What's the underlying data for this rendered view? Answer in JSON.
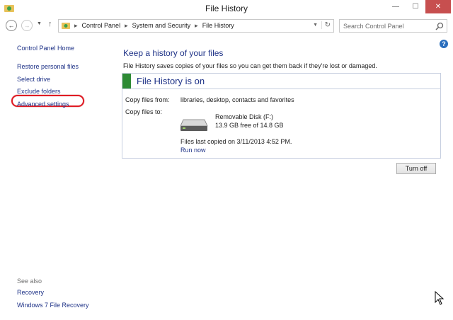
{
  "window": {
    "title": "File History"
  },
  "nav": {
    "breadcrumbs": [
      "Control Panel",
      "System and Security",
      "File History"
    ],
    "search_placeholder": "Search Control Panel"
  },
  "sidebar": {
    "home": "Control Panel Home",
    "links": [
      "Restore personal files",
      "Select drive",
      "Exclude folders",
      "Advanced settings"
    ],
    "see_also_label": "See also",
    "see_also_links": [
      "Recovery",
      "Windows 7 File Recovery"
    ]
  },
  "main": {
    "title": "Keep a history of your files",
    "description": "File History saves copies of your files so you can get them back if they're lost or damaged.",
    "status_title": "File History is on",
    "status_color": "#2e8b35",
    "copy_from_label": "Copy files from:",
    "copy_from_value": "libraries, desktop, contacts and favorites",
    "copy_to_label": "Copy files to:",
    "drive_name": "Removable Disk (F:)",
    "drive_space": "13.9 GB free of 14.8 GB",
    "last_copied": "Files last copied on 3/11/2013 4:52 PM.",
    "run_now": "Run now",
    "turn_off": "Turn off"
  },
  "colors": {
    "link": "#1e3287",
    "highlight_ring": "#e01b24",
    "close_button": "#c74f4f"
  }
}
